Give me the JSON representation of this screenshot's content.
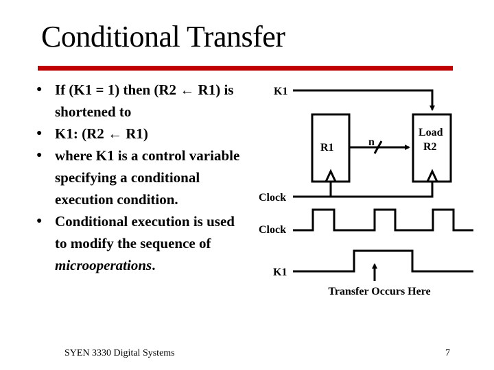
{
  "slide": {
    "title": "Conditional Transfer",
    "accent_color": "#c00000",
    "bullets": [
      {
        "lines": [
          "If (K1 = 1) then (R2 ← R1) is",
          "shortened to"
        ]
      },
      {
        "lines": [
          "K1: (R2 ← R1)"
        ]
      },
      {
        "lines": [
          "where K1 is a control variable",
          "specifying a conditional",
          "execution condition."
        ]
      },
      {
        "lines": [
          "Conditional execution is used",
          "to modify the sequence of"
        ],
        "italic_line": "microoperations",
        "italic_suffix": "."
      }
    ],
    "bullet_glyph": "●"
  },
  "diagram": {
    "k1_label": "K1",
    "r1_label": "R1",
    "r2_label_line1": "Load",
    "r2_label_line2": "R2",
    "bus_width_label": "n",
    "clock_label": "Clock"
  },
  "timing": {
    "clock_label": "Clock",
    "k1_label": "K1",
    "annotation": "Transfer Occurs Here"
  },
  "footer": {
    "course": "SYEN 3330 Digital Systems",
    "page_number": "7"
  }
}
